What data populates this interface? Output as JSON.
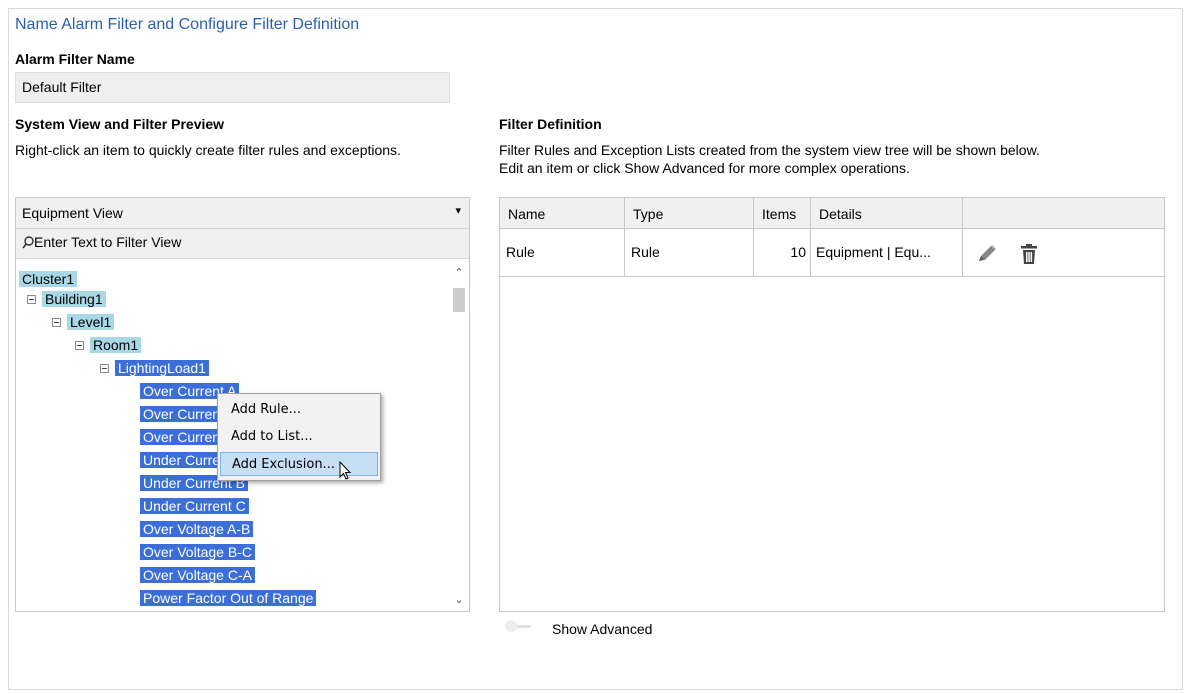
{
  "page_title": "Name Alarm Filter and Configure Filter Definition",
  "filter_name": {
    "label": "Alarm Filter Name",
    "value": "Default Filter"
  },
  "system_view": {
    "heading": "System View and Filter Preview",
    "hint": "Right-click an item to quickly create filter rules and exceptions.",
    "view_select": "Equipment View",
    "search_placeholder": "Enter Text to Filter View",
    "tree": [
      {
        "label": "Cluster1"
      },
      {
        "label": "Building1"
      },
      {
        "label": "Level1"
      },
      {
        "label": "Room1"
      },
      {
        "label": "LightingLoad1"
      },
      {
        "label": "Over Current A"
      },
      {
        "label": "Over Current B"
      },
      {
        "label": "Over Current C"
      },
      {
        "label": "Under Current A"
      },
      {
        "label": "Under Current B"
      },
      {
        "label": "Under Current C"
      },
      {
        "label": "Over Voltage A-B"
      },
      {
        "label": "Over Voltage B-C"
      },
      {
        "label": "Over Voltage C-A"
      },
      {
        "label": "Power Factor Out of Range"
      }
    ]
  },
  "context_menu": {
    "items": [
      {
        "label": "Add Rule..."
      },
      {
        "label": "Add to List..."
      },
      {
        "label": "Add Exclusion..."
      }
    ]
  },
  "filter_definition": {
    "heading": "Filter Definition",
    "hint_line1": "Filter Rules and Exception Lists created from the system view tree will be shown below.",
    "hint_line2": "Edit an item or click Show Advanced for more complex operations.",
    "columns": [
      "Name",
      "Type",
      "Items",
      "Details",
      ""
    ],
    "rows": [
      {
        "name": "Rule",
        "type": "Rule",
        "items": "10",
        "details": "Equipment | Equ..."
      }
    ]
  },
  "show_advanced": {
    "label": "Show Advanced",
    "enabled": false
  },
  "colors": {
    "title": "#2a5fb0",
    "selection": "#3b6ed8",
    "light_selection": "#a8d8e6",
    "menu_hover": "#c6dff4"
  }
}
